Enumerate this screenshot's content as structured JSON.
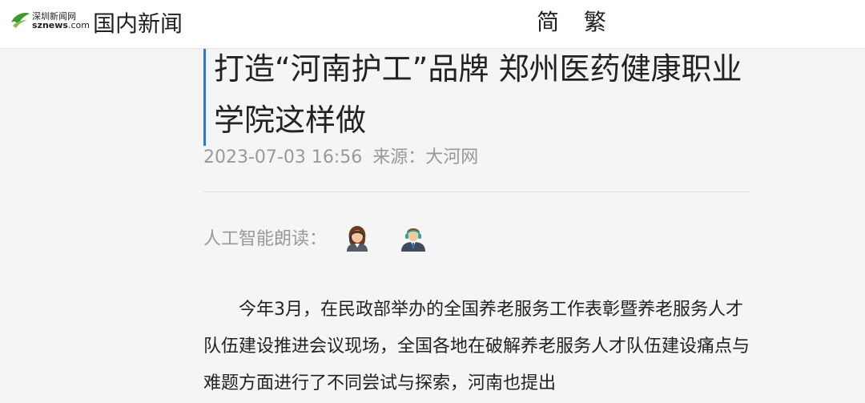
{
  "header": {
    "logo_cn": "深圳新闻网",
    "logo_en_main": "sznews",
    "logo_en_suffix": ".com",
    "section_title": "国内新闻",
    "lang_simplified": "简",
    "lang_traditional": "繁"
  },
  "article": {
    "title": "打造“河南护工”品牌 郑州医药健康职业学院这样做",
    "date": "2023-07-03 16:56",
    "source_label": "来源：",
    "source": "大河网",
    "tts_label": "人工智能朗读：",
    "body": "今年3月，在民政部举办的全国养老服务工作表彰暨养老服务人才队伍建设推进会议现场，全国各地在破解养老服务人才队伍建设痛点与难题方面进行了不同尝试与探索，河南也提出"
  },
  "icons": {
    "logo": "leaf-logo-icon",
    "voice_female": "female-announcer-icon",
    "voice_male": "male-announcer-icon"
  },
  "colors": {
    "title_bar_accent": "#3a74c9",
    "logo_green": "#3f9a2e",
    "meta_gray": "#999999"
  }
}
